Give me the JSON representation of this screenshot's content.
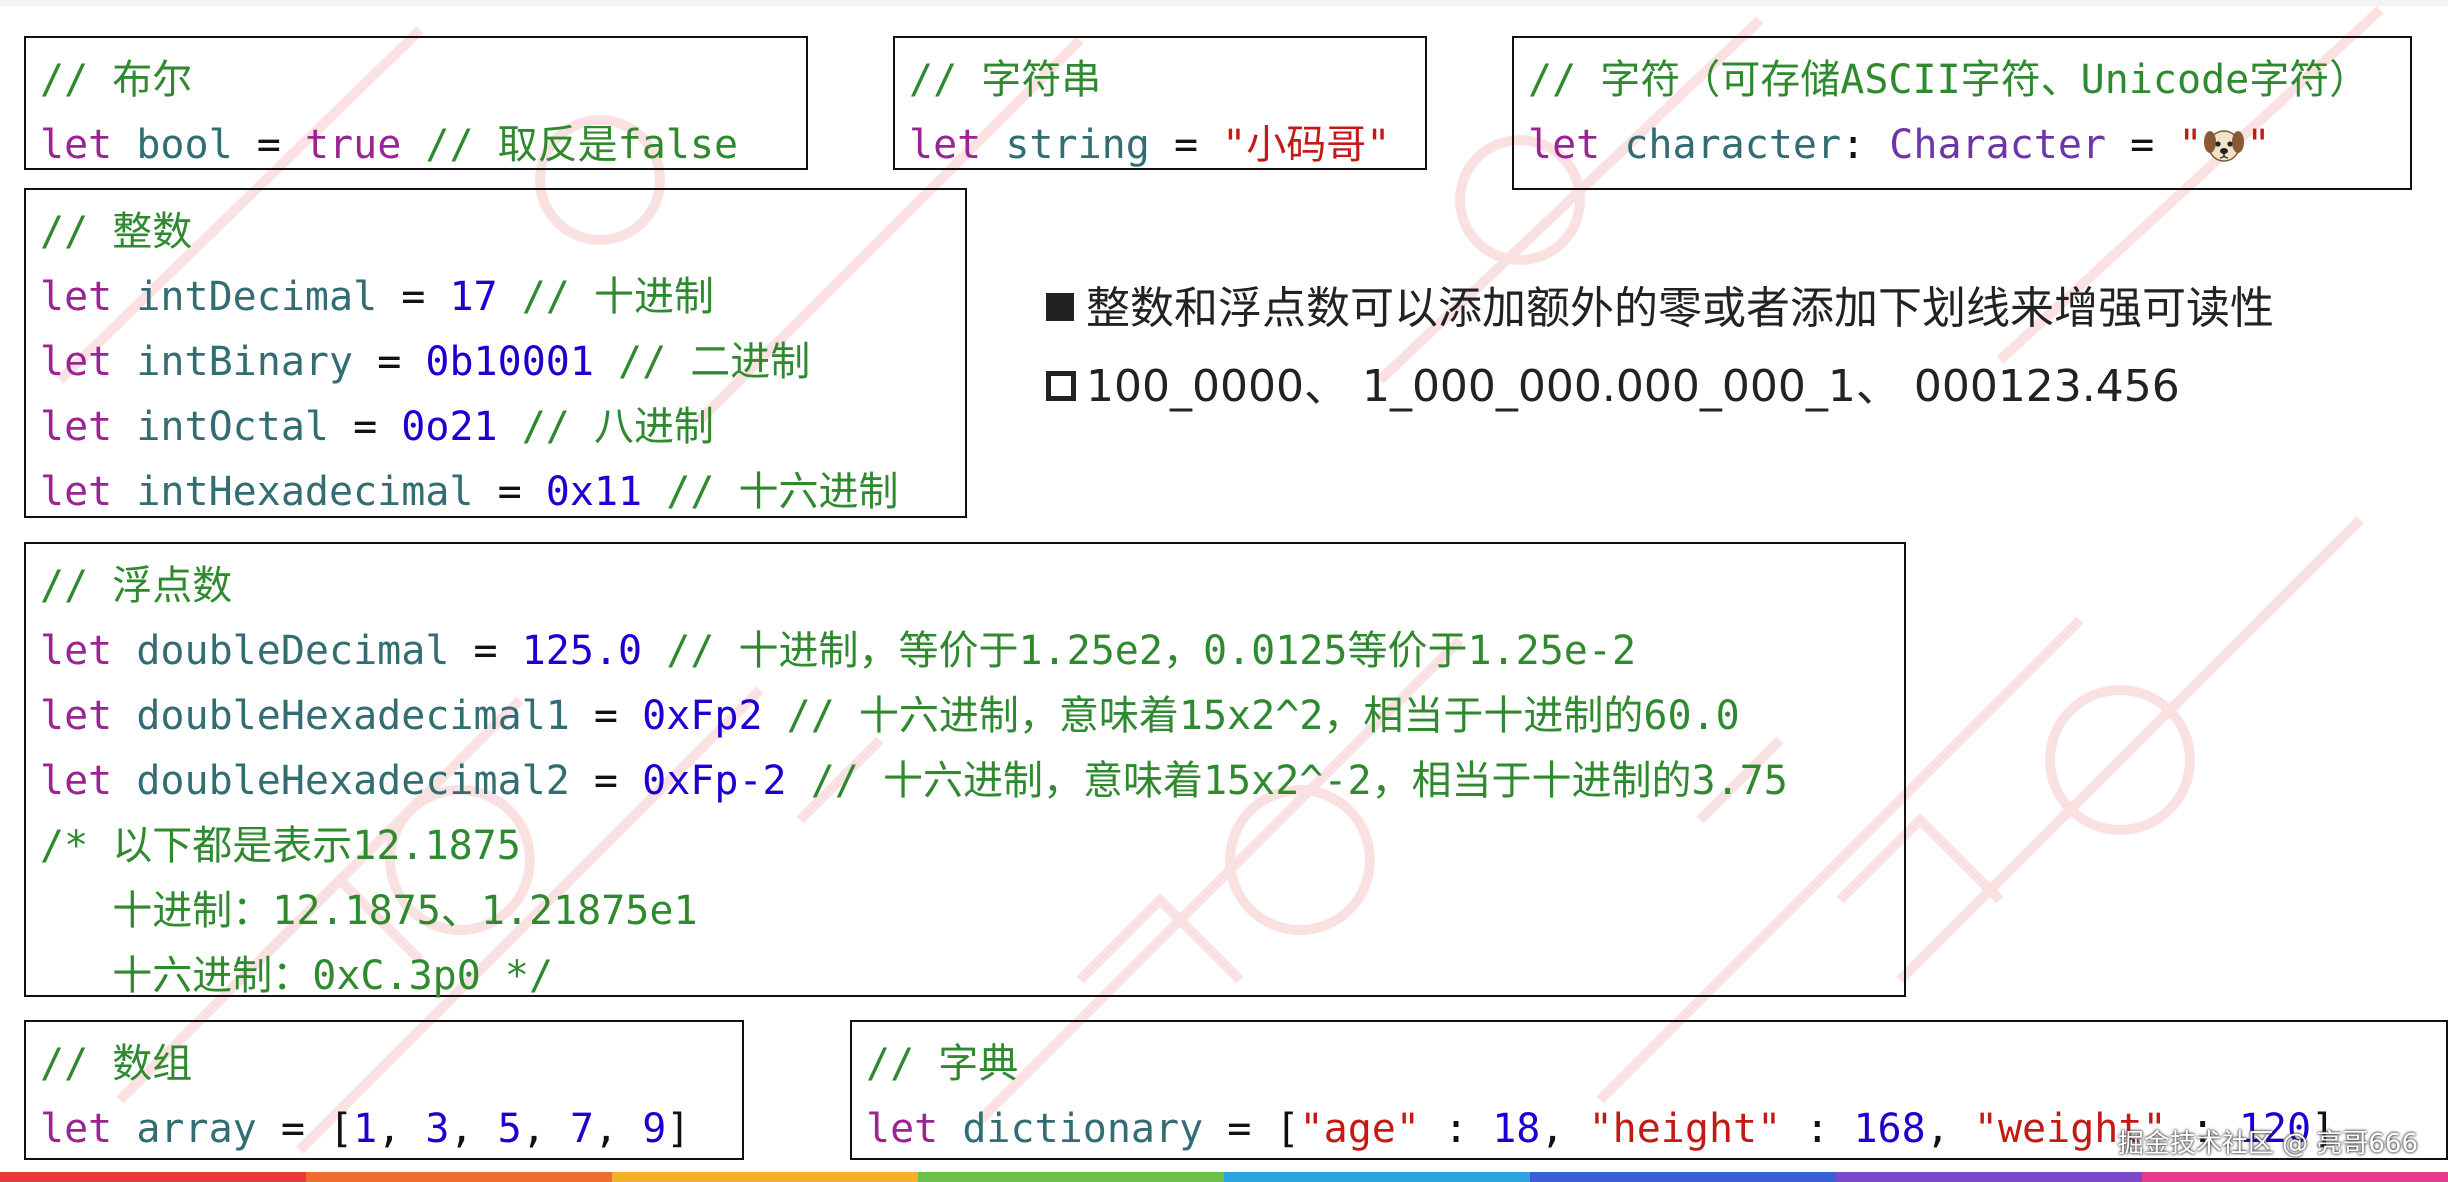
{
  "code_boxes": {
    "bool": {
      "comment": "// 布尔",
      "kw": "let",
      "name": "bool",
      "op": "=",
      "value": "true",
      "trail": "// 取反是false"
    },
    "string": {
      "comment": "// 字符串",
      "kw": "let",
      "name": "string",
      "op": "=",
      "value": "\"小码哥\""
    },
    "character": {
      "comment": "// 字符（可存储ASCII字符、Unicode字符）",
      "kw": "let",
      "name": "character",
      "colon": ":",
      "type": "Character",
      "op": "=",
      "quote_open": "\"",
      "emoji_icon": "dog-face-icon",
      "quote_close": "\""
    },
    "integers": {
      "comment": "// 整数",
      "rows": [
        {
          "kw": "let",
          "name": "intDecimal",
          "op": "=",
          "value": "17",
          "trail": "// 十进制"
        },
        {
          "kw": "let",
          "name": "intBinary",
          "op": "=",
          "value": "0b10001",
          "trail": "// 二进制"
        },
        {
          "kw": "let",
          "name": "intOctal",
          "op": "=",
          "value": "0o21",
          "trail": "// 八进制"
        },
        {
          "kw": "let",
          "name": "intHexadecimal",
          "op": "=",
          "value": "0x11",
          "trail": "// 十六进制"
        }
      ]
    },
    "floats": {
      "comment": "// 浮点数",
      "rows": [
        {
          "kw": "let",
          "name": "doubleDecimal",
          "op": "=",
          "value": "125.0",
          "trail": "// 十进制，等价于1.25e2，0.0125等价于1.25e-2"
        },
        {
          "kw": "let",
          "name": "doubleHexadecimal1",
          "op": "=",
          "value": "0xFp2",
          "trail": "// 十六进制，意味着15x2^2，相当于十进制的60.0"
        },
        {
          "kw": "let",
          "name": "doubleHexadecimal2",
          "op": "=",
          "value": "0xFp-2",
          "trail": "// 十六进制，意味着15x2^-2，相当于十进制的3.75"
        }
      ],
      "block_comment": [
        "/* 以下都是表示12.1875",
        "   十进制：12.1875、1.21875e1",
        "   十六进制：0xC.3p0 */"
      ]
    },
    "array": {
      "comment": "// 数组",
      "kw": "let",
      "name": "array",
      "op": "=",
      "open": "[",
      "items": [
        "1",
        "3",
        "5",
        "7",
        "9"
      ],
      "sep": ", ",
      "close": "]"
    },
    "dictionary": {
      "comment": "// 字典",
      "kw": "let",
      "name": "dictionary",
      "op": "=",
      "open": "[",
      "k1": "\"age\"",
      "v1": "18",
      "k2": "\"height\"",
      "v2": "168",
      "k3": "\"weight\"",
      "v3": "120",
      "colon": " : ",
      "sep": ", ",
      "close": "]"
    }
  },
  "notes": {
    "line1": "整数和浮点数可以添加额外的零或者添加下划线来增强可读性",
    "line2": "100_0000、 1_000_000.000_000_1、 000123.456"
  },
  "credit": "掘金技术社区 @ 亮哥666",
  "colors": {
    "keyword": "#9b2393",
    "type": "#6c36a9",
    "identifier": "#326d74",
    "number": "#1c00cf",
    "string": "#c41a16",
    "comment": "#2f8a2f",
    "rainbow": [
      "#e83a3a",
      "#ef6c2a",
      "#f4b02a",
      "#6ac14a",
      "#2ba6e0",
      "#3a5fd8",
      "#7a48c8",
      "#e83a8a"
    ]
  }
}
